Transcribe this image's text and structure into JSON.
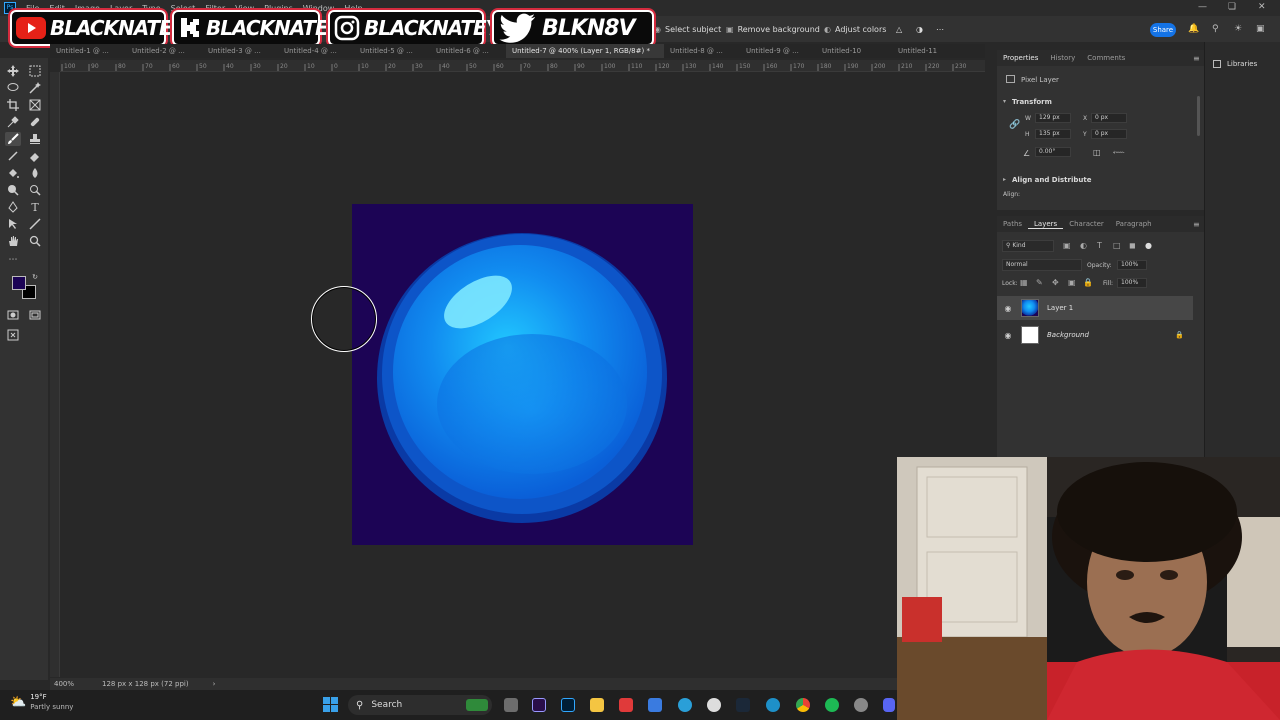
{
  "menubar": {
    "items": [
      "File",
      "Edit",
      "Image",
      "Layer",
      "Type",
      "Select",
      "Filter",
      "View",
      "Plugins",
      "Window",
      "Help"
    ]
  },
  "options": {
    "select_subject": "Select subject",
    "remove_background": "Remove background",
    "adjust_colors": "Adjust colors",
    "share": "Share"
  },
  "banners": [
    {
      "text": "BLACKNATE",
      "icon": "youtube-icon",
      "color": "#e62117"
    },
    {
      "text": "BLACKNATE",
      "icon": "kick-icon",
      "color": "#ffffff"
    },
    {
      "text": "BLACKNATEYT",
      "icon": "instagram-icon",
      "color": "#ffffff"
    },
    {
      "text": "BLKN8V",
      "icon": "twitter-icon",
      "color": "#ffffff"
    }
  ],
  "tabs": [
    {
      "label": "Untitled-1 @ ..."
    },
    {
      "label": "Untitled-2 @ ..."
    },
    {
      "label": "Untitled-3 @ ..."
    },
    {
      "label": "Untitled-4 @ ..."
    },
    {
      "label": "Untitled-5 @ ..."
    },
    {
      "label": "Untitled-6 @ ..."
    },
    {
      "label": "Untitled-7 @ 400% (Layer 1, RGB/8#) *"
    },
    {
      "label": "Untitled-8 @ ..."
    },
    {
      "label": "Untitled-9 @ ..."
    },
    {
      "label": "Untitled-10"
    },
    {
      "label": "Untitled-11"
    }
  ],
  "ruler": {
    "ticks": [
      "100",
      "90",
      "80",
      "70",
      "60",
      "50",
      "40",
      "30",
      "20",
      "10",
      "0",
      "10",
      "20",
      "30",
      "40",
      "50",
      "60",
      "70",
      "80",
      "90",
      "100",
      "110",
      "120",
      "130",
      "140",
      "150",
      "160",
      "170",
      "180",
      "190",
      "200",
      "210",
      "220",
      "230"
    ]
  },
  "status": {
    "zoom": "400%",
    "doc_info": "128 px x 128 px (72 ppi)"
  },
  "properties": {
    "tabs": [
      "Properties",
      "History",
      "Comments"
    ],
    "layer_type": "Pixel Layer",
    "transform_title": "Transform",
    "w_label": "W",
    "w_value": "129 px",
    "h_label": "H",
    "h_value": "135 px",
    "x_label": "X",
    "x_value": "0 px",
    "y_label": "Y",
    "y_value": "0 px",
    "angle_value": "0.00°",
    "align_title": "Align and Distribute",
    "align_label": "Align:"
  },
  "layers": {
    "tabs": [
      "Paths",
      "Layers",
      "Character",
      "Paragraph"
    ],
    "filter_kind": "Kind",
    "blend_mode": "Normal",
    "opacity_label": "Opacity:",
    "opacity_value": "100%",
    "lock_label": "Lock:",
    "fill_label": "Fill:",
    "fill_value": "100%",
    "items": [
      {
        "name": "Layer 1",
        "selected": true
      },
      {
        "name": "Background",
        "selected": false
      }
    ]
  },
  "libraries": {
    "label": "Libraries"
  },
  "taskbar": {
    "weather_temp": "19°F",
    "weather_desc": "Partly sunny",
    "search_label": "Search"
  },
  "colors": {
    "foreground": "#1c0455",
    "background": "#000000",
    "accent": "#1473e6",
    "doc_bg": "#1c0455"
  }
}
